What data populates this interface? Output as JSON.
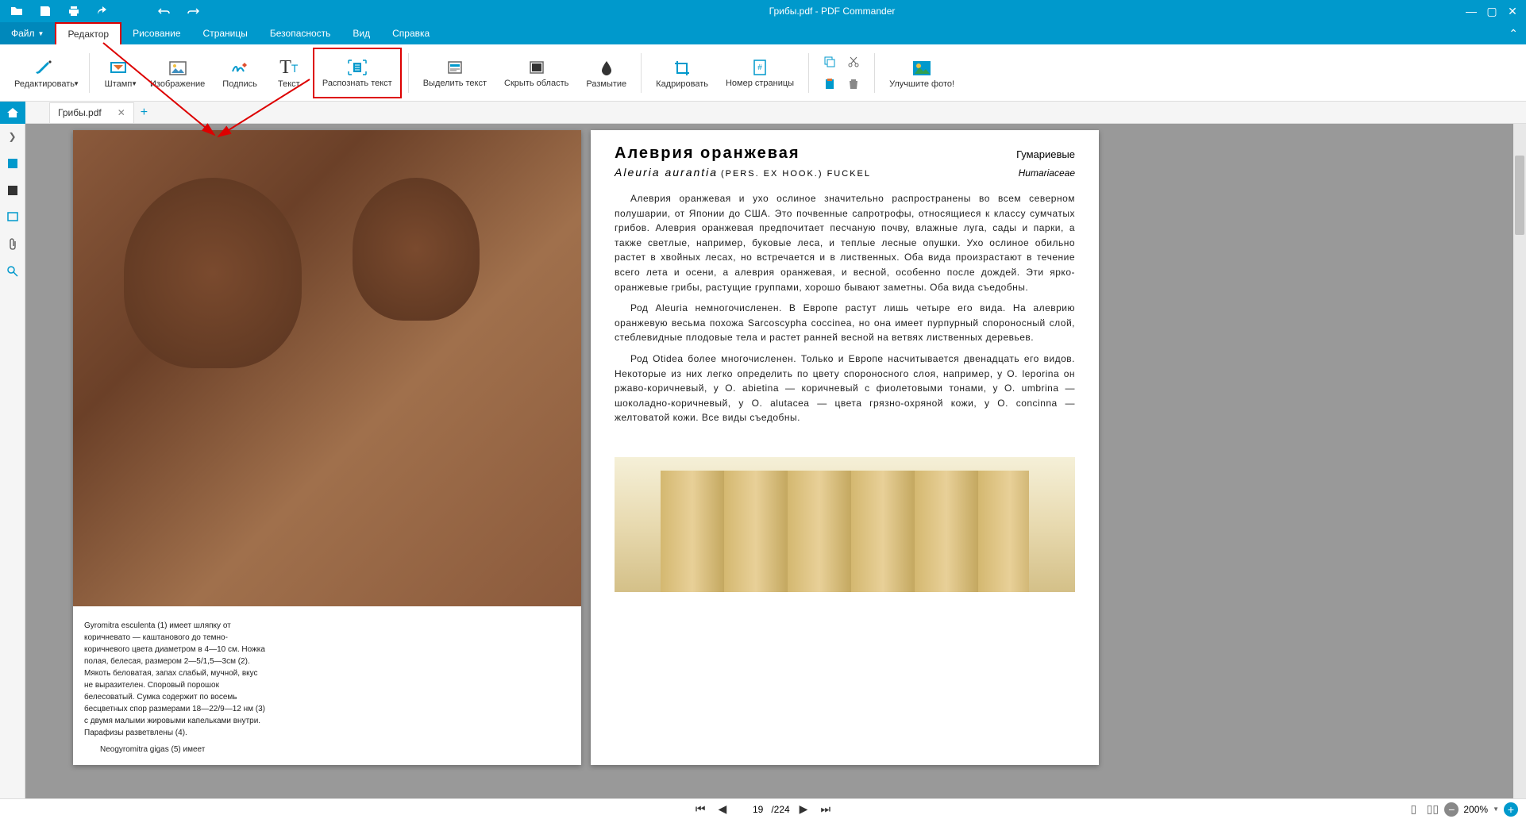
{
  "app": {
    "title": "Грибы.pdf - PDF Commander"
  },
  "menu": {
    "file": "Файл",
    "editor": "Редактор",
    "drawing": "Рисование",
    "pages": "Страницы",
    "security": "Безопасность",
    "view": "Вид",
    "help": "Справка"
  },
  "tools": {
    "edit": "Редактировать",
    "stamp": "Штамп",
    "image": "Изображение",
    "signature": "Подпись",
    "text": "Текст",
    "ocr": "Распознать текст",
    "highlight": "Выделить текст",
    "hide": "Скрыть область",
    "blur": "Размытие",
    "crop": "Кадрировать",
    "pagenum": "Номер страницы",
    "enhance": "Улучшите фото!"
  },
  "tab": {
    "name": "Грибы.pdf"
  },
  "status": {
    "page": "19",
    "total": "/224",
    "zoom": "200%"
  },
  "doc": {
    "left_caption": "Gyromitra esculenta (1) имеет шляпку от коричневато — каштанового до темно-коричневого цвета диаметром в 4—10 см. Ножка полая, белесая, размером 2—5/1,5—3см (2). Мякоть беловатая, запах слабый, мучной, вкус не выразителен. Споровый порошок белесоватый. Сумка содержит по восемь бесцветных спор размерами 18—22/9—12 нм (3) с двумя малыми жировыми капельками внутри. Парафизы разветвлены (4).",
    "left_caption_2": "Neogyromitra gigas (5) имеет",
    "right": {
      "title": "Алеврия оранжевая",
      "family": "Гумариевые",
      "latin": "Aleuria aurantia",
      "latin_author": "(PERS. EX HOOK.) FUCKEL",
      "family_latin": "Humariaceae",
      "p1": "Алеврия оранжевая и ухо ослиное значительно распространены во всем северном полушарии, от Японии до США. Это почвенные сапротрофы, относящиеся к классу сумчатых грибов. Алеврия оранжевая предпочитает песчаную почву, влажные луга, сады и парки, а также светлые, например, буковые леса, и теплые лесные опушки. Ухо ослиное обильно растет в хвойных лесах, но встречается и в лиственных. Оба вида произрастают в течение всего лета и осени, а алеврия оранжевая, и весной, особенно после дождей. Эти ярко-оранжевые грибы, растущие группами, хорошо бывают заметны. Оба вида съедобны.",
      "p2": "Род Aleuria немногочисленен. В Европе растут лишь четыре его вида. На алеврию оранжевую весьма похожа Sarcoscypha coccinea, но она имеет пурпурный спороносный слой, стеблевидные плодовые тела и растет ранней весной на ветвях лиственных деревьев.",
      "p3": "Род Otidea более многочисленен. Только и Европе насчитывается двенадцать его видов. Некоторые из них легко определить по цвету спороносного слоя, например, у O. leporina он ржаво-коричневый, у O. abietina — коричневый с фиолетовыми тонами, у O. umbrina — шоколадно-коричневый, у O. alutacea — цвета грязно-охряной кожи, у O. concinna — желтоватой кожи. Все виды съедобны."
    }
  }
}
